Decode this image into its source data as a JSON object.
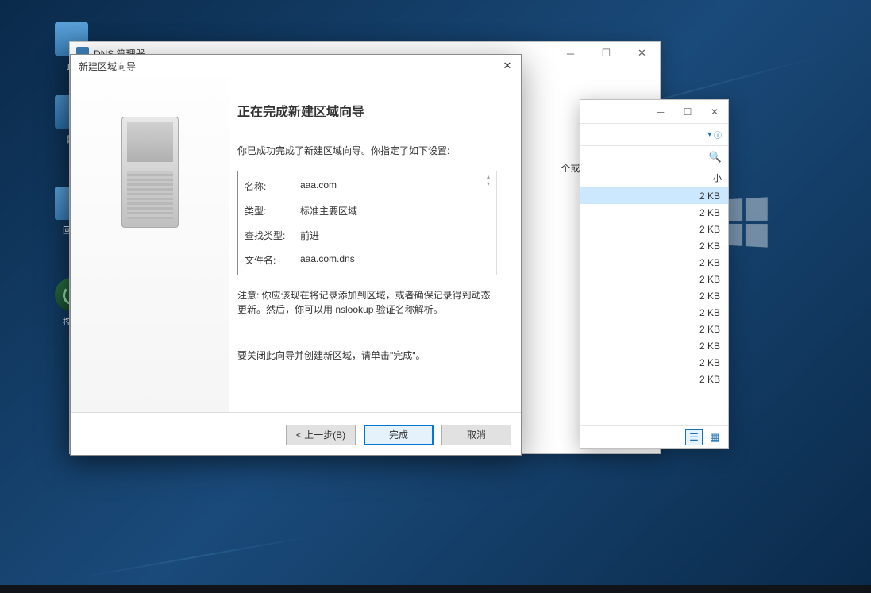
{
  "desktop": {
    "pc": "此",
    "net": "网",
    "bin": "回收",
    "ctrl": "控制"
  },
  "dns_mgr": {
    "title": "DNS 管理器",
    "side_text": "个或多个连续的 DNS"
  },
  "explorer": {
    "dropdown_hint": "▾",
    "header_col": "小",
    "rows": [
      "2 KB",
      "2 KB",
      "2 KB",
      "2 KB",
      "2 KB",
      "2 KB",
      "2 KB",
      "2 KB",
      "2 KB",
      "2 KB",
      "2 KB",
      "2 KB"
    ]
  },
  "wizard": {
    "title": "新建区域向导",
    "heading": "正在完成新建区域向导",
    "intro": "你已成功完成了新建区域向导。你指定了如下设置:",
    "summary": {
      "name_label": "名称:",
      "name_value": "aaa.com",
      "type_label": "类型:",
      "type_value": "标准主要区域",
      "lookup_label": "查找类型:",
      "lookup_value": "前进",
      "file_label": "文件名:",
      "file_value": "aaa.com.dns"
    },
    "note": "注意: 你应该现在将记录添加到区域，或者确保记录得到动态更新。然后，你可以用 nslookup 验证名称解析。",
    "closing": "要关闭此向导并创建新区域，请单击\"完成\"。",
    "buttons": {
      "back": "< 上一步(B)",
      "finish": "完成",
      "cancel": "取消"
    }
  }
}
